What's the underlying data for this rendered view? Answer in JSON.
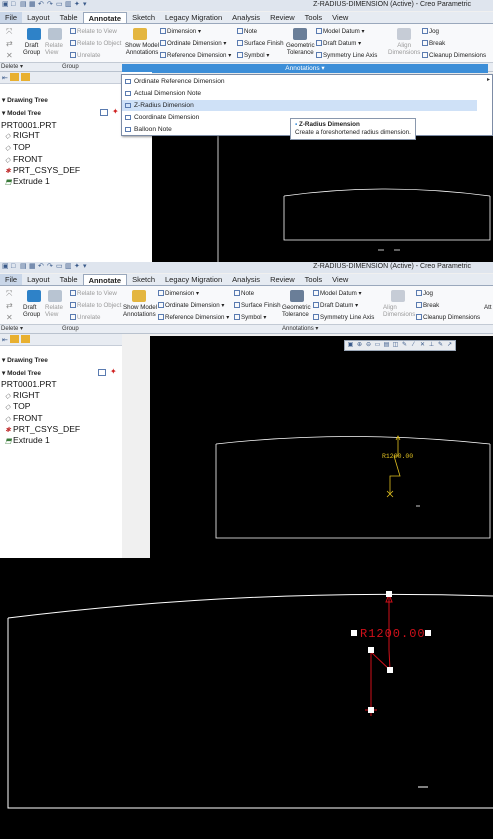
{
  "window_title": "Z-RADIUS-DIMENSION (Active) - Creo Parametric",
  "tabs": [
    "File",
    "Layout",
    "Table",
    "Annotate",
    "Sketch",
    "Legacy Migration",
    "Analysis",
    "Review",
    "Tools",
    "View"
  ],
  "active_tab": "Annotate",
  "ribbon": {
    "delete": "Delete",
    "draft_group": "Draft\nGroup",
    "relate_view": "Relate\nView",
    "relate_to_view": "Relate to View",
    "relate_to_object": "Relate to Object",
    "unrelate": "Unrelate",
    "show_model_annotations": "Show Model\nAnnotations",
    "dimension": "Dimension",
    "ordinate_dimension": "Ordinate Dimension",
    "reference_dimension": "Reference Dimension",
    "note": "Note",
    "surface_finish": "Surface Finish",
    "symbol": "Symbol",
    "geometric_tolerance": "Geometric\nTolerance",
    "model_datum": "Model Datum",
    "draft_datum": "Draft Datum",
    "symmetry_line_axis": "Symmetry Line Axis",
    "align_dimensions": "Align\nDimensions",
    "jog": "Jog",
    "break": "Break",
    "cleanup_dimensions": "Cleanup Dimensions",
    "group_label": "Group",
    "annotations_label": "Annotations",
    "attach_partial": "Att"
  },
  "annotations_menu": {
    "header": "Annotations",
    "items": [
      "Ordinate Reference Dimension",
      "Actual Dimension Note",
      "Z-Radius Dimension",
      "Coordinate Dimension",
      "Balloon Note"
    ],
    "highlighted": "Z-Radius Dimension"
  },
  "tooltip": {
    "title": "Z-Radius Dimension",
    "description": "Create a foreshortened radius dimension."
  },
  "tree": {
    "drawing_tree": "Drawing Tree",
    "model_tree": "Model Tree",
    "root": "PRT0001.PRT",
    "items": [
      "RIGHT",
      "TOP",
      "FRONT",
      "PRT_CSYS_DEF",
      "Extrude 1"
    ]
  },
  "dimension_value": "R1200.00",
  "colors": {
    "active_tab_bg": "#ffffff",
    "annotations_bar": "#3c8ed8",
    "menu_highlight": "#cfe1f7",
    "dimension_red": "#d0101a",
    "dimension_yellow": "#e0c020",
    "canvas": "#000000",
    "geometry": "#ffffff"
  }
}
